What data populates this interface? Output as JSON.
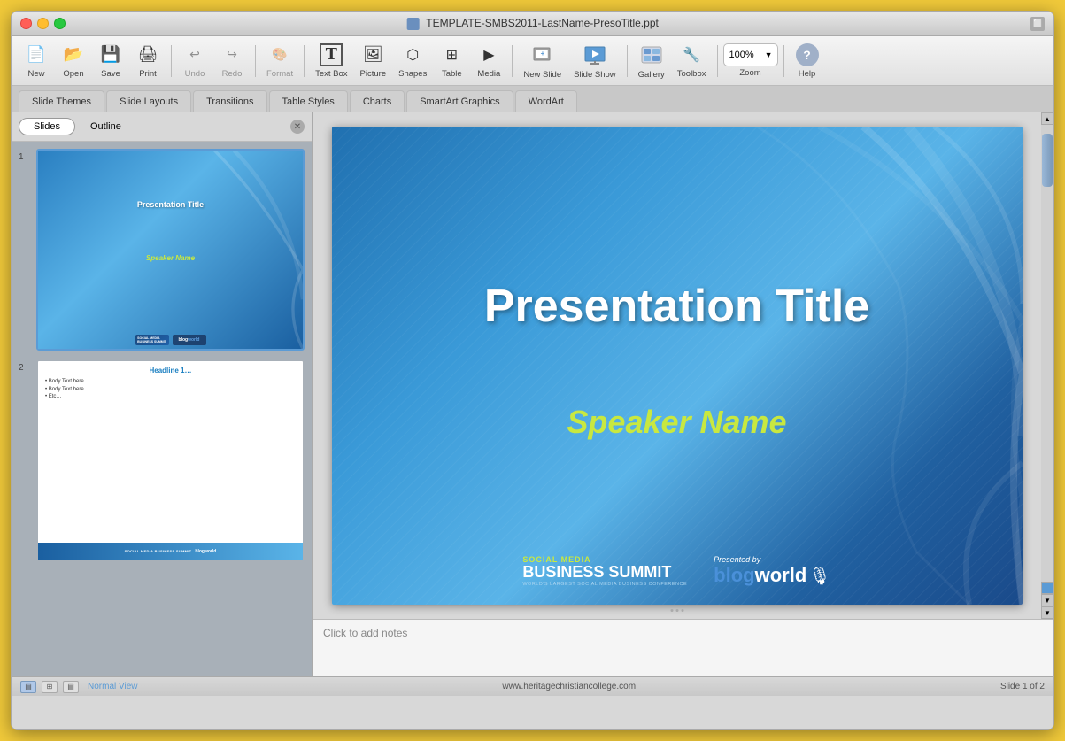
{
  "window": {
    "title": "TEMPLATE-SMBS2011-LastName-PresoTitle.ppt"
  },
  "toolbar": {
    "buttons": [
      {
        "id": "new",
        "label": "New",
        "icon": "📄"
      },
      {
        "id": "open",
        "label": "Open",
        "icon": "📂"
      },
      {
        "id": "save",
        "label": "Save",
        "icon": "💾"
      },
      {
        "id": "print",
        "label": "Print",
        "icon": "🖨"
      },
      {
        "id": "undo",
        "label": "Undo",
        "icon": "↩"
      },
      {
        "id": "redo",
        "label": "Redo",
        "icon": "↪"
      },
      {
        "id": "format",
        "label": "Format",
        "icon": "🎨"
      },
      {
        "id": "textbox",
        "label": "Text Box",
        "icon": "T"
      },
      {
        "id": "picture",
        "label": "Picture",
        "icon": "🖼"
      },
      {
        "id": "shapes",
        "label": "Shapes",
        "icon": "⬡"
      },
      {
        "id": "table",
        "label": "Table",
        "icon": "⊞"
      },
      {
        "id": "media",
        "label": "Media",
        "icon": "▶"
      },
      {
        "id": "newslide",
        "label": "New Slide",
        "icon": "➕"
      },
      {
        "id": "slideshow",
        "label": "Slide Show",
        "icon": "▷"
      },
      {
        "id": "gallery",
        "label": "Gallery",
        "icon": "⊟"
      },
      {
        "id": "toolbox",
        "label": "Toolbox",
        "icon": "🔧"
      },
      {
        "id": "zoom",
        "label": "Zoom",
        "icon": "🔍"
      },
      {
        "id": "help",
        "label": "Help",
        "icon": "?"
      }
    ],
    "zoom_value": "100%"
  },
  "ribbon": {
    "tabs": [
      {
        "id": "slide-themes",
        "label": "Slide Themes",
        "active": false
      },
      {
        "id": "slide-layouts",
        "label": "Slide Layouts",
        "active": false
      },
      {
        "id": "transitions",
        "label": "Transitions",
        "active": false
      },
      {
        "id": "table-styles",
        "label": "Table Styles",
        "active": false
      },
      {
        "id": "charts",
        "label": "Charts",
        "active": false
      },
      {
        "id": "smartart",
        "label": "SmartArt Graphics",
        "active": false
      },
      {
        "id": "wordart",
        "label": "WordArt",
        "active": false
      }
    ]
  },
  "slide_panel": {
    "tabs": [
      {
        "id": "slides",
        "label": "Slides",
        "active": true
      },
      {
        "id": "outline",
        "label": "Outline",
        "active": false
      }
    ],
    "slides": [
      {
        "num": 1,
        "title": "Presentation Title",
        "subtitle": "Speaker Name"
      },
      {
        "num": 2,
        "headline": "Headline 1…",
        "body_items": [
          "Body Text here",
          "Body Text here",
          "Etc…"
        ]
      }
    ]
  },
  "main_slide": {
    "title": "Presentation Title",
    "speaker_name": "Speaker Name",
    "footer": {
      "social_media_label": "SOCIAL MEDIA",
      "business_summit": "BUSINESS SUMMIT",
      "conference_label": "WORLD'S LARGEST SOCIAL MEDIA BUSINESS CONFERENCE",
      "presented_by": "Presented by",
      "blogworld": "blogworld"
    }
  },
  "notes": {
    "placeholder": "Click to add notes"
  },
  "status_bar": {
    "url": "www.heritagechristiancollege.com",
    "slide_info": "Slide 1 of 2",
    "view_normal": "Normal View"
  }
}
